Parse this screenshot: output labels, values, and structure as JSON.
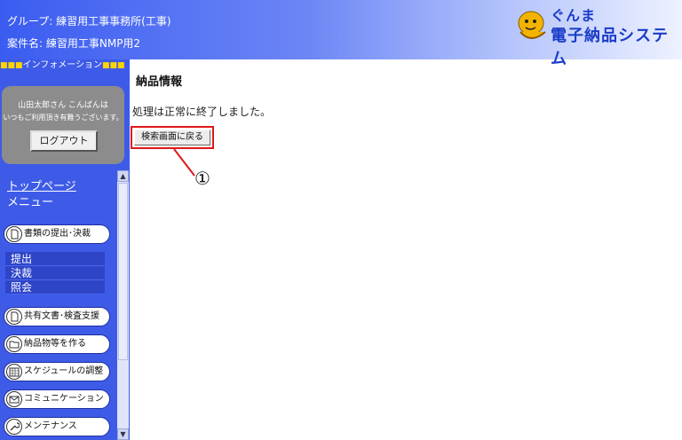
{
  "header": {
    "group_line": "グループ: 練習用工事事務所(工事)",
    "case_line": "案件名: 練習用工事NMP用2",
    "logo_line1": "ぐんま",
    "logo_line2": "電子納品システム"
  },
  "sidebar": {
    "info_marks_left": "■■■",
    "info_title": "インフォメーション",
    "info_marks_right": "■■■",
    "greeting": "山田太郎さん こんばんは",
    "greeting2": "いつもご利用頂き有難うございます。",
    "logout_label": "ログアウト",
    "top_page_link": "トップページ",
    "menu_label": "メニュー",
    "menu_items": [
      {
        "label": "書類の提出･決裁",
        "icon": "document-icon"
      },
      {
        "label": "共有文書･検査支援",
        "icon": "document-icon"
      },
      {
        "label": "納品物等を作る",
        "icon": "folder-icon"
      },
      {
        "label": "スケジュールの調整",
        "icon": "calendar-icon"
      },
      {
        "label": "コミュニケーション",
        "icon": "mail-icon"
      },
      {
        "label": "メンテナンス",
        "icon": "wrench-icon"
      }
    ],
    "sub_items": [
      "提出",
      "決裁",
      "照会"
    ]
  },
  "main": {
    "title": "納品情報",
    "message": "処理は正常に終了しました。",
    "back_button_label": "検索画面に戻る",
    "callout_number": "①"
  },
  "colors": {
    "sidebar_bg": "#3e5be8",
    "accent_red": "#e01818"
  }
}
